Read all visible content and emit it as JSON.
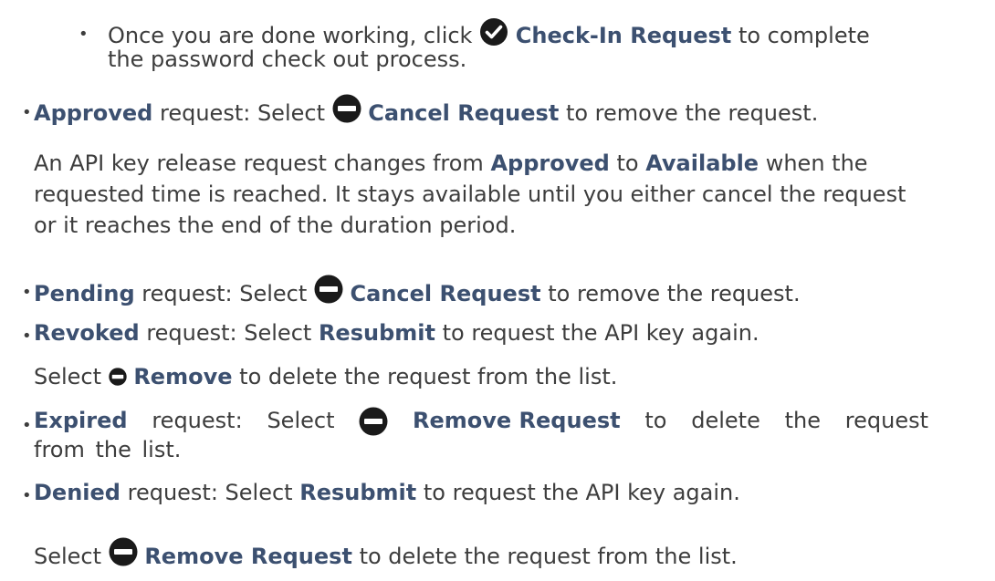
{
  "bullet_char": "•",
  "items": [
    {
      "id": "checkin",
      "line1_prefix": "Once you are done working, click",
      "line1_term": "Check-In Request",
      "line1_suffix": "to complete",
      "line2": "the password check out process.",
      "icon": "check-circle-icon"
    },
    {
      "id": "approved",
      "term": "Approved",
      "text_a": "request: Select",
      "action": "Cancel Request",
      "text_b": "to remove the request.",
      "icon": "minus-circle-icon",
      "note_l1_a": "An API key release request changes from",
      "note_l1_t1": "Approved",
      "note_l1_b": "to",
      "note_l1_t2": "Available",
      "note_l1_c": "when the",
      "note_l2": "requested time is reached. It stays available until you either cancel the request",
      "note_l3": "or it reaches the end of the duration period."
    },
    {
      "id": "pending",
      "term": "Pending",
      "text_a": "request: Select",
      "action": "Cancel Request",
      "text_b": "to remove the request.",
      "icon": "minus-circle-icon"
    },
    {
      "id": "revoked",
      "term": "Revoked",
      "text_a": "request: Select",
      "action": "Resubmit",
      "text_b": "to request the API key again.",
      "sub_a": "Select",
      "sub_action": "Remove",
      "sub_b": "to delete the request from the list.",
      "icon": "minus-circle-icon"
    },
    {
      "id": "expired",
      "term": "Expired",
      "text_a": "request:",
      "text_select": "Select",
      "action": "Remove Request",
      "text_b1": "to",
      "text_b2": "delete",
      "text_b3": "the",
      "text_b4": "request",
      "line2": "from the list.",
      "icon": "minus-circle-icon"
    },
    {
      "id": "denied",
      "term": "Denied",
      "text_a": "request: Select",
      "action": "Resubmit",
      "text_b": "to request the API key again.",
      "sub_a": "Select",
      "sub_action": "Remove Request",
      "sub_b": "to delete the request from the list.",
      "icon": "minus-circle-icon"
    }
  ]
}
